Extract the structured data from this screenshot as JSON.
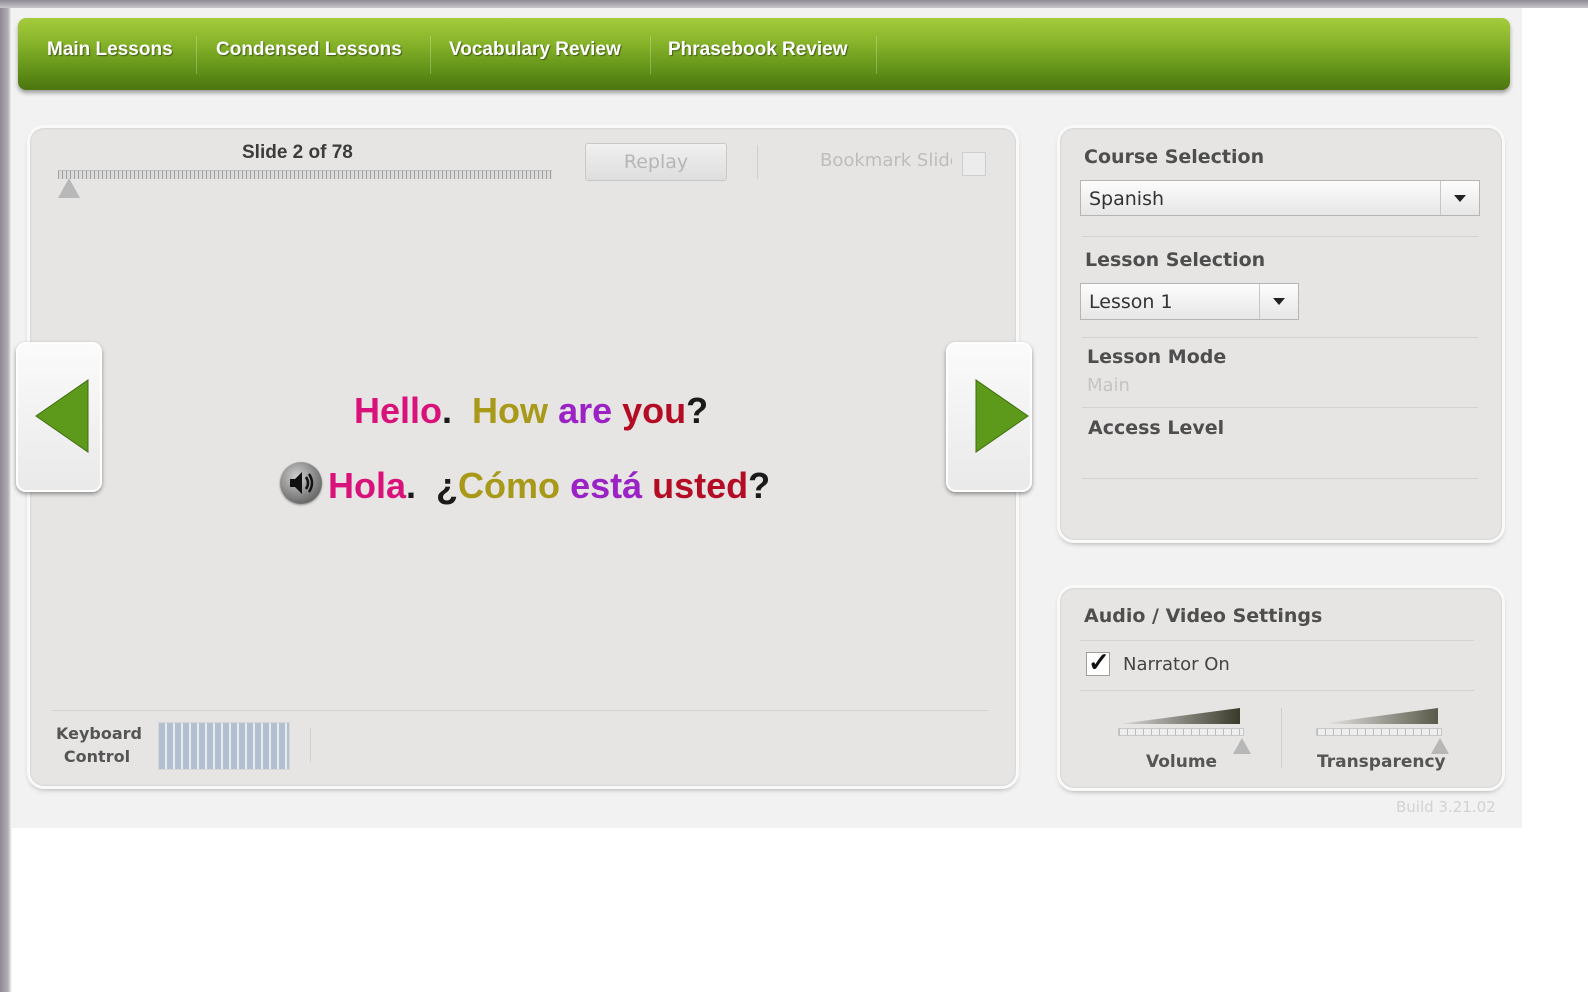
{
  "nav": {
    "items": [
      {
        "label": "Main Lessons"
      },
      {
        "label": "Condensed Lessons"
      },
      {
        "label": "Vocabulary Review"
      },
      {
        "label": "Phrasebook Review"
      }
    ]
  },
  "slide": {
    "counter": "Slide 2 of 78",
    "progress": 0.0128,
    "replay_label": "Replay",
    "bookmark_label": "Bookmark Slide"
  },
  "sentence_en": {
    "words": [
      {
        "text": "Hello",
        "color": "#d8127a"
      },
      {
        "text": ".",
        "color": "#1a1a1a"
      },
      {
        "text": "How",
        "color": "#a89a18"
      },
      {
        "text": "are",
        "color": "#9b22c4"
      },
      {
        "text": "you",
        "color": "#b50c25"
      },
      {
        "text": "?",
        "color": "#1a1a1a"
      }
    ]
  },
  "sentence_es": {
    "words": [
      {
        "text": "Hola",
        "color": "#d8127a"
      },
      {
        "text": ".",
        "color": "#1a1a1a"
      },
      {
        "text": "¿",
        "color": "#1a1a1a"
      },
      {
        "text": "Cómo",
        "color": "#a89a18"
      },
      {
        "text": "está",
        "color": "#9b22c4"
      },
      {
        "text": "usted",
        "color": "#b50c25"
      },
      {
        "text": "?",
        "color": "#1a1a1a"
      }
    ]
  },
  "icons": {
    "prev": "arrow-left-icon",
    "next": "arrow-right-icon",
    "speaker": "speaker-icon",
    "keyboard": "keyboard-icon"
  },
  "keyboard": {
    "label_line1": "Keyboard",
    "label_line2": "Control"
  },
  "course": {
    "heading": "Course Selection",
    "selected": "Spanish",
    "lesson_heading": "Lesson Selection",
    "lesson_selected": "Lesson 1",
    "mode_heading": "Lesson Mode",
    "mode_value": "Main",
    "access_heading": "Access Level"
  },
  "av": {
    "heading": "Audio / Video Settings",
    "narrator_label": "Narrator On",
    "narrator_checked": true,
    "volume_label": "Volume",
    "volume_level": 1.0,
    "transparency_label": "Transparency",
    "transparency_level": 1.0
  },
  "build": "Build 3.21.02",
  "colors": {
    "nav_green": "#6f9f1f",
    "arrow_green": "#5d9a1c"
  }
}
